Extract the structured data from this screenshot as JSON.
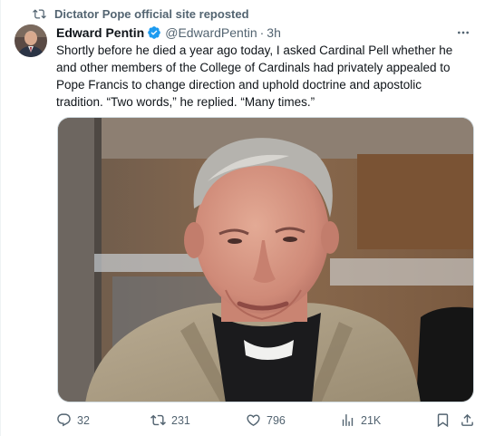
{
  "repost": {
    "label": "Dictator Pope official site reposted",
    "icon": "repost-icon"
  },
  "tweet": {
    "author_name": "Edward Pentin",
    "handle": "@EdwardPentin",
    "separator": "·",
    "time": "3h",
    "verified": true,
    "text_lines": [
      "Shortly before he died a year ago today, I asked Cardinal Pell whether he",
      "and other members of the College of Cardinals had privately appealed to",
      "Pope Francis to change direction and uphold doctrine and apostolic",
      "tradition. “Two words,” he replied. “Many times.”"
    ]
  },
  "actions": {
    "replies": "32",
    "reposts": "231",
    "likes": "796",
    "views": "21K"
  },
  "colors": {
    "text": "#0f1419",
    "secondary": "#536471",
    "verified": "#1d9bf0",
    "border": "#cfd9de"
  }
}
